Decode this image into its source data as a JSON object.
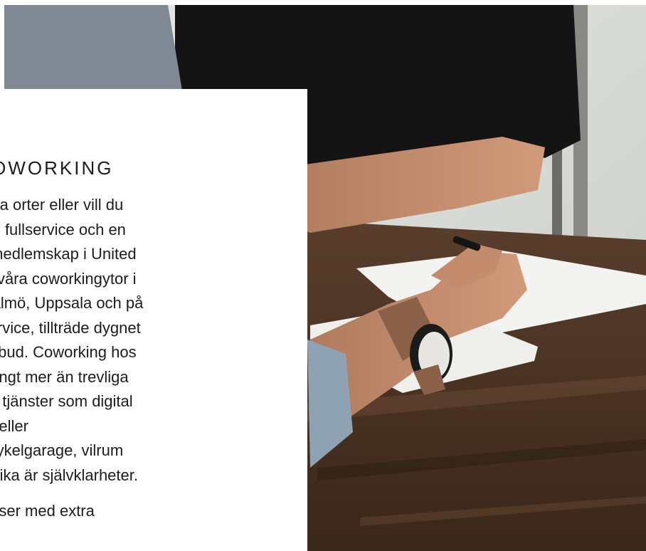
{
  "image": {
    "subject": "photo-hand-writing",
    "colors": {
      "table": "#4a3325",
      "shirt": "#141414",
      "paper": "#f1f1ef",
      "wall": "#d8dad6"
    }
  },
  "card": {
    "heading": "ED COWORKING",
    "lines": [
      "et på flera orter eller vill du",
      "larbetare fullservice och en",
      "Köp till medlemskap i United",
      "gång till våra coworkingytor i",
      "borg, Malmö, Uppsala och på",
      "ed fullservice, tillträde dygnet",
      " tjänsteutbud. Coworking hos",
      "bjuder långt mer än trevliga",
      "sägs om tjänster som digital",
      "å jobbet eller",
      "rvice? Cykelgarage, vilrum",
      "schysst fika är självklarheter."
    ],
    "tail_line": "rbetsplatser med extra"
  }
}
